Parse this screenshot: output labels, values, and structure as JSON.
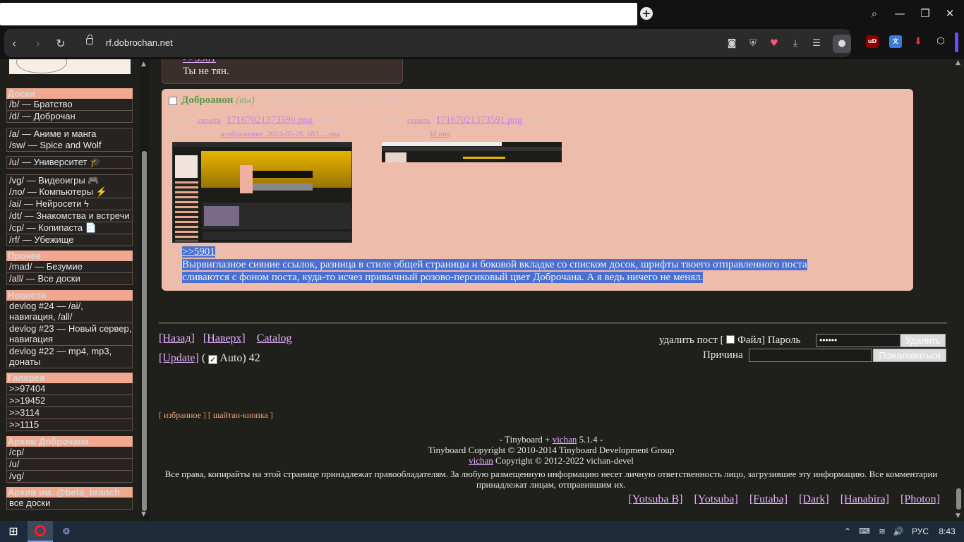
{
  "browser": {
    "url": "rf.dobrochan.net",
    "new_tab_glyph": "+",
    "ext_ublock_label": "uD"
  },
  "sidebar": {
    "sections": [
      {
        "title": "Доски",
        "items": [
          "/b/ — Братство",
          "/d/ — Доброчан"
        ]
      },
      {
        "title": "",
        "items": [
          "/a/ — Аниме и манга",
          "/sw/ — Spice and Wolf"
        ]
      },
      {
        "title": "",
        "items": [
          "/u/ — Университет 🎓"
        ]
      },
      {
        "title": "",
        "items": [
          "/vg/ — Видеоигры 🎮",
          "/ло/ — Компьютеры ⚡",
          "/ai/ — Нейросети ϟ",
          "/dt/ — Знакомства и встречи",
          "/cp/ — Копипаста 📄",
          "/rf/ — Убежище"
        ]
      },
      {
        "title": "Прочее",
        "items": [
          "/mad/ — Безумие",
          "/all/ — Все доски"
        ]
      },
      {
        "title": "Новости",
        "items": [
          "devlog #24 — /ai/, навигация, /all/",
          "devlog #23 — Новый сервер, навигация",
          "devlog #22 — mp4, mp3, донаты"
        ]
      },
      {
        "title": "Галерея",
        "items": [
          ">>97404",
          ">>19452",
          ">>3114",
          ">>1115"
        ]
      },
      {
        "title": "Архив Доброчана",
        "items": [
          "/cp/",
          "/u/",
          "/vg/"
        ]
      },
      {
        "title": "Архив им. @beta_branch",
        "items": [
          "все доски"
        ]
      }
    ]
  },
  "prev_reply": {
    "ref": ">>5901",
    "text": "Ты не тян."
  },
  "post": {
    "name": "Доброанон",
    "you": "(вы)",
    "date": "26.05.2024 08:42:17 (Вс)",
    "number": "No.5903",
    "file1": {
      "label": "Файл",
      "action": "скрыть",
      "filename": "17167021373590.png",
      "meta1": "(726,62",
      "meta2": "КБ, 1366x768,",
      "orig_name": "изображение_2024-05-26_083... .png"
    },
    "file2": {
      "label": "Файл",
      "action": "скрыть",
      "filename": "17167021373591.png",
      "meta1": "(37,15",
      "meta2": "КБ, 1366x136,",
      "orig_name": "Ы.png"
    },
    "ref": ">>5901",
    "text_line1": "Вырвиглазное сияние ссылок, разница в стиле общей страницы и боковой вкладке со списком досок, шрифты твоего отправленного поста",
    "text_line2": "сливаются с фоном поста, куда-то исчез привычный розово-персиковый цвет Доброчана. А я ведь ничего не менял."
  },
  "thread_nav": {
    "back": "[Назад]",
    "top": "[Наверх]",
    "catalog": "Catalog",
    "update": "[Update]",
    "auto_open": "(",
    "auto_label": "Auto)",
    "count": "42"
  },
  "delete_form": {
    "label": "удалить пост [",
    "file_label": "Файл]",
    "password_label": "Пароль",
    "password_value": "••••••",
    "delete_button": "Удалить",
    "reason_label": "Причина",
    "report_button": "Пожаловаться"
  },
  "footer_links": {
    "open": "[",
    "favorites": "избранное",
    "sep": "]  [",
    "shaitan": "шайтан-кнопка",
    "close": "]"
  },
  "footer": {
    "line1_prefix": "- Tinyboard +",
    "vichan": "vichan",
    "line1_suffix": "5.1.4 -",
    "line2": "Tinyboard Copyright © 2010-2014 Tinyboard Development Group",
    "line3_link": "vichan",
    "line3_suffix": "Copyright © 2012-2022 vichan-devel",
    "disclaimer1": "Все права, копирайты на этой странице принадлежат правообладателям. За любую размещенную информацию несет личную ответственность лицо, загрузившее эту информацию. Все комментарии",
    "disclaimer2": "принадлежат лицам, отправившим их."
  },
  "styles": [
    "[Yotsuba B]",
    "[Yotsuba]",
    "[Futaba]",
    "[Dark]",
    "[Hanabira]",
    "[Photon]"
  ],
  "taskbar": {
    "lang": "РУС",
    "time": "8:43"
  },
  "colors": {
    "post_bg": "#eebcaa",
    "link": "#c880e8",
    "sidebar_head": "#f0a890",
    "selection": "#4a6fd0"
  }
}
